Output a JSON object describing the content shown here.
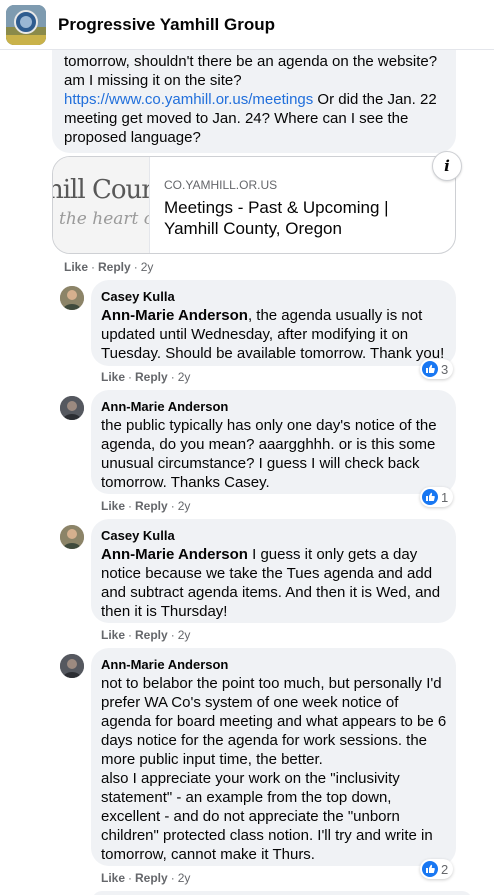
{
  "header": {
    "title": "Progressive Yamhill Group",
    "avatar_icon": "group-landscape-avatar"
  },
  "first_comment": {
    "line1": "tomorrow, shouldn't there be an agenda on the website?",
    "line2": "am I missing it on the site?",
    "link": "https://www.co.yamhill.or.us/meetings",
    "line3_rest": " Or did the Jan. 22",
    "line4": "meeting get moved to Jan. 24? Where can I see the",
    "line5": "proposed language?",
    "preview": {
      "thumb_line1": "hill Coun",
      "thumb_line2": "the heart of",
      "domain": "CO.YAMHILL.OR.US",
      "title": "Meetings - Past & Upcoming | Yamhill County, Oregon",
      "info_icon": "i"
    },
    "actions": {
      "like": "Like",
      "reply": "Reply",
      "time": "2y"
    }
  },
  "replies": [
    {
      "author": "Casey Kulla",
      "mention": "Ann-Marie Anderson",
      "text": ", the agenda usually is not updated until Wednesday, after modifying it on Tuesday. Should be available tomorrow. Thank you!",
      "likes": "3",
      "actions": {
        "like": "Like",
        "reply": "Reply",
        "time": "2y"
      }
    },
    {
      "author": "Ann-Marie Anderson",
      "mention": "",
      "text": "the public typically has only one day's notice of the agenda, do you mean? aaargghhh. or is this some unusual circumstance? I guess I will check back tomorrow. Thanks Casey.",
      "likes": "1",
      "actions": {
        "like": "Like",
        "reply": "Reply",
        "time": "2y"
      }
    },
    {
      "author": "Casey Kulla",
      "mention": "Ann-Marie Anderson",
      "text": " I guess it only gets a day notice because we take the Tues agenda and add and subtract agenda items. And then it is Wed, and then it is Thursday!",
      "likes": "",
      "actions": {
        "like": "Like",
        "reply": "Reply",
        "time": "2y"
      }
    },
    {
      "author": "Ann-Marie Anderson",
      "mention": "",
      "text": "not to belabor the point too much, but personally I'd prefer WA Co's system of one week notice of agenda for board meeting and what appears to be 6 days notice for the agenda for work sessions. the more public input time, the better.",
      "text2": "also I appreciate your work on the \"inclusivity statement\" - an example from the top down, excellent - and do not appreciate the \"unborn children\" protected class notion. I'll try and write in tomorrow, cannot make it Thurs.",
      "likes": "2",
      "actions": {
        "like": "Like",
        "reply": "Reply",
        "time": "2y"
      }
    }
  ],
  "colors": {
    "bubble": "#f0f2f5",
    "link": "#216fdb",
    "like_blue": "#1877f2",
    "meta_gray": "#65676b"
  }
}
